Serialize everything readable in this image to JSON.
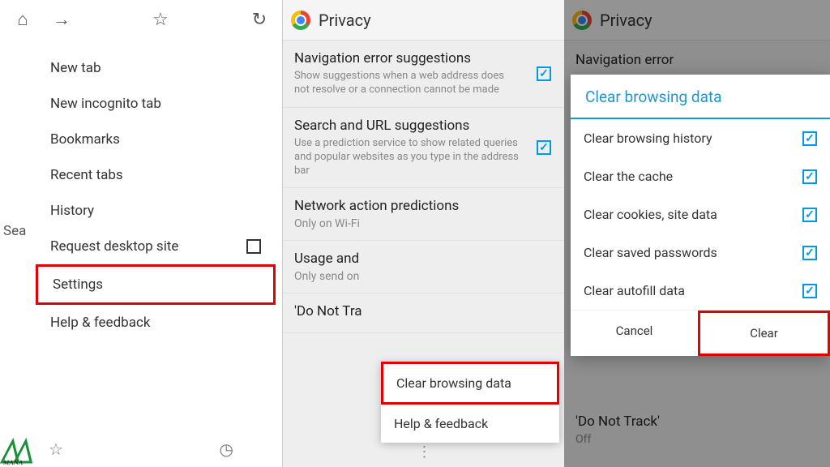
{
  "panel1": {
    "search_fragment": "Sea",
    "menu": {
      "items": [
        {
          "label": "New tab"
        },
        {
          "label": "New incognito tab"
        },
        {
          "label": "Bookmarks"
        },
        {
          "label": "Recent tabs"
        },
        {
          "label": "History"
        },
        {
          "label": "Request desktop site",
          "has_checkbox": true
        },
        {
          "label": "Settings",
          "highlighted": true
        },
        {
          "label": "Help & feedback"
        }
      ]
    }
  },
  "panel2": {
    "header_title": "Privacy",
    "settings": [
      {
        "title": "Navigation error suggestions",
        "desc": "Show suggestions when a web address does not resolve or a connection cannot be made",
        "checked": true
      },
      {
        "title": "Search and URL suggestions",
        "desc": "Use a prediction service to show related queries and popular websites as you type in the address bar",
        "checked": true
      },
      {
        "title": "Network action predictions",
        "sub": "Only on Wi-Fi"
      },
      {
        "title": "Usage and",
        "sub": "Only send on"
      },
      {
        "title": "'Do Not Tra"
      }
    ],
    "popup": {
      "items": [
        {
          "label": "Clear browsing data",
          "highlighted": true
        },
        {
          "label": "Help & feedback"
        }
      ]
    }
  },
  "panel3": {
    "header_title": "Privacy",
    "bg_item_title": "Navigation error",
    "bg_bottom_title": "'Do Not Track'",
    "bg_bottom_sub": "Off",
    "dialog": {
      "title": "Clear browsing data",
      "items": [
        {
          "label": "Clear browsing history",
          "checked": true
        },
        {
          "label": "Clear the cache",
          "checked": true
        },
        {
          "label": "Clear cookies, site data",
          "checked": true
        },
        {
          "label": "Clear saved passwords",
          "checked": true
        },
        {
          "label": "Clear autofill data",
          "checked": true
        }
      ],
      "cancel_label": "Cancel",
      "clear_label": "Clear"
    }
  },
  "watermark": "MANA APK"
}
